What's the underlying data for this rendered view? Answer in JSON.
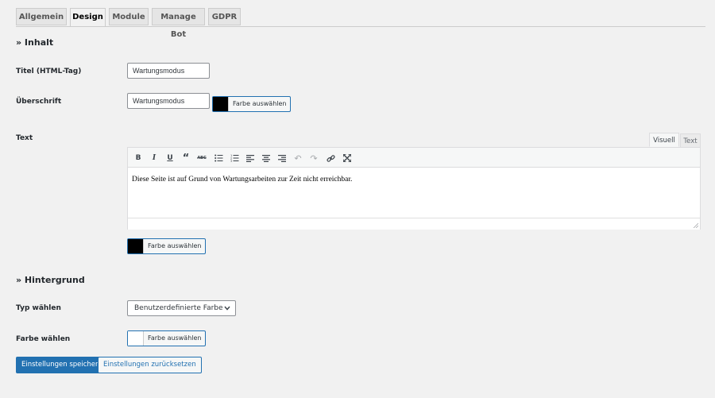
{
  "tabs": [
    {
      "label": "Allgemein"
    },
    {
      "label": "Design"
    },
    {
      "label": "Module"
    },
    {
      "label": "Manage Bot"
    },
    {
      "label": "GDPR"
    }
  ],
  "inhalt": {
    "title": "» Inhalt",
    "titel_label": "Titel (HTML-Tag)",
    "titel_value": "Wartungsmodus",
    "ueberschrift_label": "Überschrift",
    "ueberschrift_value": "Wartungsmodus",
    "text_label": "Text",
    "color_button": "Farbe auswählen",
    "heading_color": "#000000",
    "text_color": "#000000"
  },
  "editor": {
    "tab_visual": "Visuell",
    "tab_text": "Text",
    "content": "Diese Seite ist auf Grund von Wartungsarbeiten zur Zeit nicht erreichbar.",
    "toolbar": [
      "bold-icon",
      "italic-icon",
      "underline-icon",
      "blockquote-icon",
      "strikethrough-icon",
      "bullet-list-icon",
      "numbered-list-icon",
      "align-left-icon",
      "align-center-icon",
      "align-right-icon",
      "undo-icon",
      "redo-icon",
      "link-icon",
      "fullscreen-icon"
    ]
  },
  "hintergrund": {
    "title": "» Hintergrund",
    "typ_label": "Typ wählen",
    "typ_value": "Benutzerdefinierte Farbe",
    "farbe_label": "Farbe wählen",
    "color_button": "Farbe auswählen",
    "bg_color": "#ffffff"
  },
  "actions": {
    "save": "Einstellungen speichern",
    "reset": "Einstellungen zurücksetzen"
  }
}
